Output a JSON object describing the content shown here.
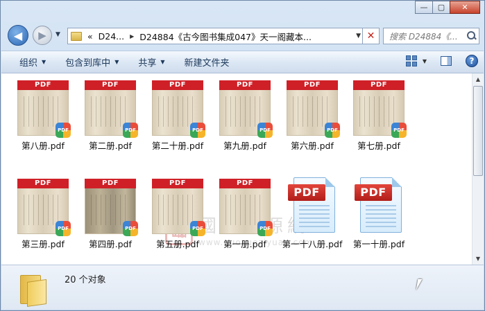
{
  "caption": {
    "min": "—",
    "max": "▢",
    "close": "✕"
  },
  "nav": {
    "back": "◀",
    "forward": "▶",
    "history": "▼"
  },
  "address": {
    "chevron": "«",
    "seg1": "D24...",
    "sep": "▶",
    "seg2": "D24884《古今图书集成047》天一阁藏本...",
    "dropdown": "▼",
    "clear": "✕"
  },
  "search": {
    "placeholder": "搜索 D24884《...",
    "icon": "search-icon"
  },
  "toolbar": {
    "organize": "组织",
    "include": "包含到库中",
    "share": "共享",
    "new_folder": "新建文件夹",
    "dd": "▼",
    "help": "?"
  },
  "files": [
    {
      "name": "第八册.pdf",
      "kind": "thumb"
    },
    {
      "name": "第二册.pdf",
      "kind": "thumb"
    },
    {
      "name": "第二十册.pdf",
      "kind": "thumb"
    },
    {
      "name": "第九册.pdf",
      "kind": "thumb"
    },
    {
      "name": "第六册.pdf",
      "kind": "thumb"
    },
    {
      "name": "第七册.pdf",
      "kind": "thumb"
    },
    {
      "name": "第三册.pdf",
      "kind": "thumb"
    },
    {
      "name": "第四册.pdf",
      "kind": "thumb-dark"
    },
    {
      "name": "第五册.pdf",
      "kind": "thumb"
    },
    {
      "name": "第一册.pdf",
      "kind": "thumb"
    },
    {
      "name": "第一十八册.pdf",
      "kind": "pdf-icon"
    },
    {
      "name": "第一十册.pdf",
      "kind": "pdf-icon"
    }
  ],
  "thumb_band": "PDF",
  "thumb_badge": "PDF",
  "pdf_tag": "PDF",
  "watermark": {
    "seal": "臨",
    "title": "國學資源網",
    "url": "www.guoxueziyuan.com"
  },
  "status": {
    "count": "20 个对象"
  },
  "colors": {
    "pdf_red": "#cf2027",
    "window_bg": "#c4d7ec",
    "link_text": "#1e395b"
  }
}
